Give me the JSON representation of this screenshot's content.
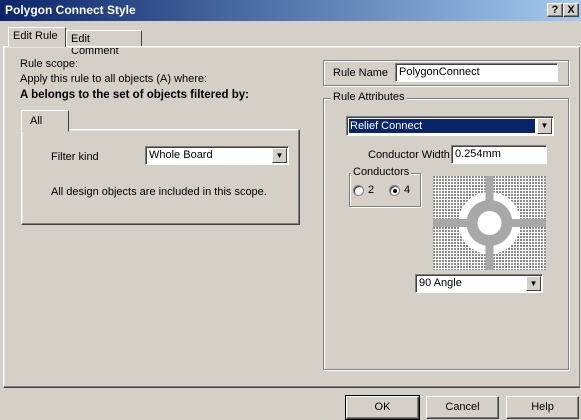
{
  "window": {
    "title": "Polygon Connect Style",
    "help_btn": "?",
    "close_btn": "X"
  },
  "tabs": {
    "edit_rule": "Edit Rule",
    "edit_comment": "Edit Comment"
  },
  "scope": {
    "heading": "Rule scope:",
    "apply_text": "Apply this rule to all objects (A) where:",
    "belongs_text": "A belongs to the set of objects filtered by:",
    "tab_all": "All",
    "filter_kind_label": "Filter kind",
    "filter_kind_value": "Whole Board",
    "description": "All design objects are included in this scope."
  },
  "rule_name": {
    "label": "Rule Name",
    "value": "PolygonConnect"
  },
  "attributes": {
    "group_label": "Rule Attributes",
    "connect_style": "Relief Connect",
    "conductor_width_label": "Conductor Width",
    "conductor_width_value": "0.254mm",
    "conductors_group": "Conductors",
    "conductors_option_2": "2",
    "conductors_option_4": "4",
    "conductors_selected": "4",
    "angle_value": "90 Angle"
  },
  "buttons": {
    "ok": "OK",
    "cancel": "Cancel",
    "help": "Help"
  },
  "colors": {
    "title_start": "#0a246a",
    "title_end": "#a6caf0",
    "selection": "#0a246a",
    "face": "#d4d0c8",
    "relief_preview": "#a8a8a8"
  }
}
